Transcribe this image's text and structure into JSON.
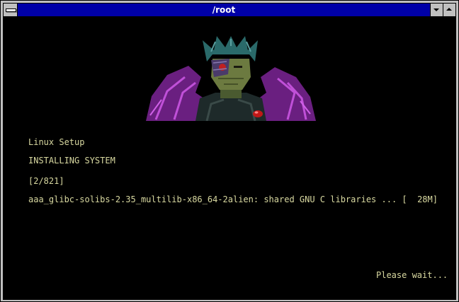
{
  "window": {
    "title": "/root"
  },
  "header_image": {
    "icon": "cyborg-portrait-illustration"
  },
  "terminal": {
    "app_name": "Linux Setup",
    "phase": "INSTALLING SYSTEM",
    "progress": "[2/821]",
    "package_line": "aaa_glibc-solibs-2.35_multilib-x86_64-2alien: shared GNU C libraries ... [  28M]",
    "status": "Please wait..."
  },
  "colors": {
    "titlebar": "#0000a8",
    "background": "#000000",
    "text": "#d8d8a0"
  }
}
